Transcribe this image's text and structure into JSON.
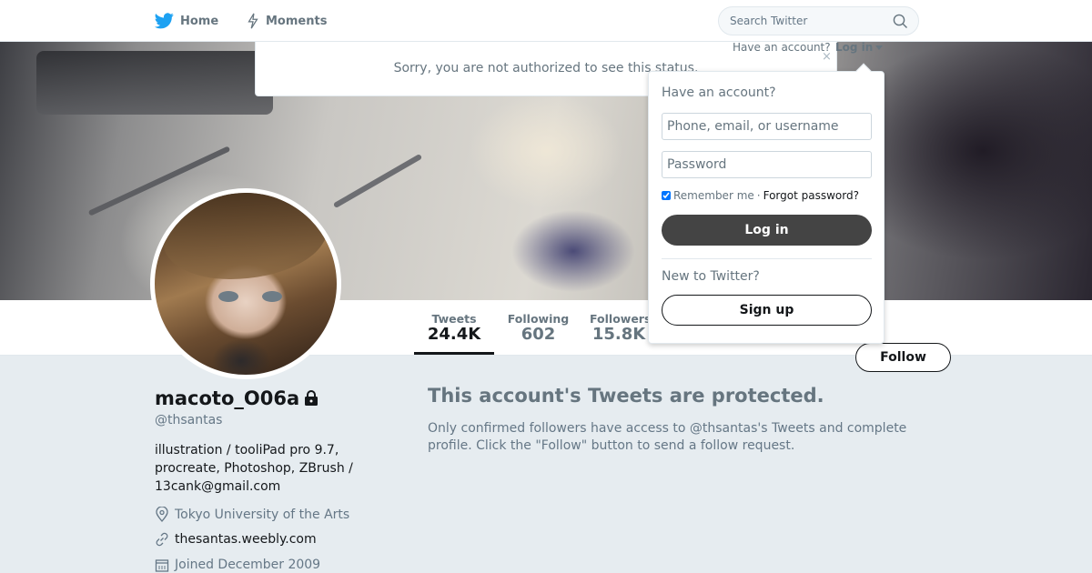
{
  "nav": {
    "home_label": "Home",
    "moments_label": "Moments",
    "search_placeholder": "Search Twitter",
    "have_account": "Have an account?",
    "login_label": "Log in",
    "brand_color": "#1da1f2"
  },
  "notice": {
    "text": "Sorry, you are not authorized to see this status.",
    "close": "×"
  },
  "profile": {
    "name": "macoto_O06a",
    "handle": "@thsantas",
    "bio": "illustration / tooliPad pro 9.7, procreate, Photoshop, ZBrush / 13cank@gmail.com",
    "location": "Tokyo University of the Arts",
    "website": "thesantas.weebly.com",
    "joined": "Joined December 2009",
    "follow_label": "Follow"
  },
  "stats": [
    {
      "label": "Tweets",
      "value": "24.4K"
    },
    {
      "label": "Following",
      "value": "602"
    },
    {
      "label": "Followers",
      "value": "15.8K"
    }
  ],
  "protected": {
    "title": "This account's Tweets are protected.",
    "description": "Only confirmed followers have access to @thsantas's Tweets and complete profile. Click the \"Follow\" button to send a follow request."
  },
  "login_dropdown": {
    "title": "Have an account?",
    "username_placeholder": "Phone, email, or username",
    "password_placeholder": "Password",
    "remember_label": "Remember me",
    "separator": "·",
    "forgot_label": "Forgot password?",
    "login_button": "Log in",
    "new_label": "New to Twitter?",
    "signup_button": "Sign up"
  }
}
